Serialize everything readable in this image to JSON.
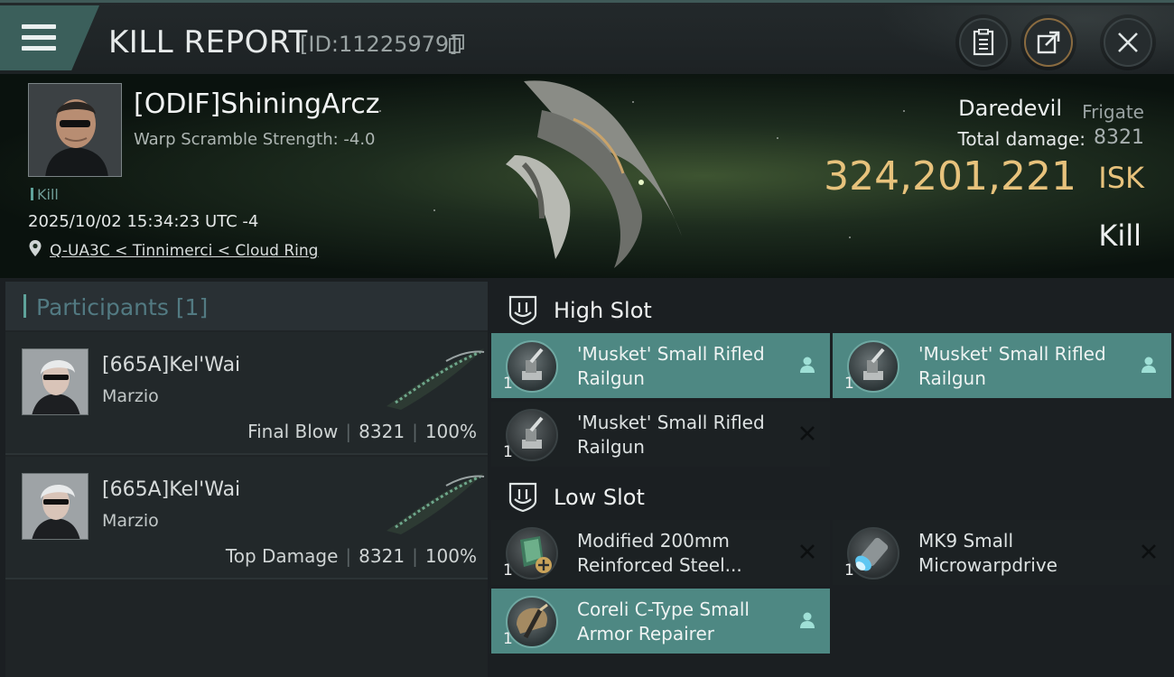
{
  "header": {
    "title": "KILL REPORT",
    "report_id": "[ID:11225979]",
    "icons": [
      "menu-icon",
      "copy-icon",
      "clipboard-icon",
      "share-icon",
      "close-icon"
    ]
  },
  "victim": {
    "name": "[ODIF]ShiningArcz",
    "warp_scramble": "Warp Scramble Strength: -4.0",
    "kill_tag": "Kill",
    "datetime": "2025/10/02 15:34:23 UTC -4",
    "location": "Q-UA3C < Tinnimerci < Cloud Ring",
    "ship_type": "Daredevil",
    "ship_class": "Frigate",
    "total_damage_label": "Total damage:",
    "total_damage": "8321",
    "isk_value": "324,201,221",
    "isk_unit": "ISK",
    "result": "Kill"
  },
  "participants": {
    "title": "Participants [1]",
    "rows": [
      {
        "name": "[665A]Kel'Wai",
        "ship": "Marzio",
        "role": "Final Blow",
        "damage": "8321",
        "percent": "100%"
      },
      {
        "name": "[665A]Kel'Wai",
        "ship": "Marzio",
        "role": "Top Damage",
        "damage": "8321",
        "percent": "100%"
      }
    ]
  },
  "fitting": {
    "high_slot": {
      "label": "High Slot",
      "modules": [
        {
          "name": "'Musket' Small Rifled Railgun",
          "qty": "1",
          "state": "dropped",
          "icon": "railgun-icon"
        },
        {
          "name": "'Musket' Small Rifled Railgun",
          "qty": "1",
          "state": "dropped",
          "icon": "railgun-icon"
        },
        {
          "name": "'Musket' Small Rifled Railgun",
          "qty": "1",
          "state": "destroyed",
          "icon": "railgun-icon"
        }
      ]
    },
    "low_slot": {
      "label": "Low Slot",
      "modules": [
        {
          "name": "Modified 200mm Reinforced Steel...",
          "qty": "1",
          "state": "destroyed",
          "icon": "armor-plate-icon"
        },
        {
          "name": "MK9 Small Microwarpdrive",
          "qty": "1",
          "state": "destroyed",
          "icon": "microwarpdrive-icon"
        },
        {
          "name": "Coreli C-Type Small Armor Repairer",
          "qty": "1",
          "state": "dropped",
          "icon": "armor-repairer-icon"
        }
      ]
    }
  },
  "colors": {
    "accent_teal": "#4e8883",
    "isk_gold": "#e7c27c",
    "panel_dark": "#1c2123"
  }
}
